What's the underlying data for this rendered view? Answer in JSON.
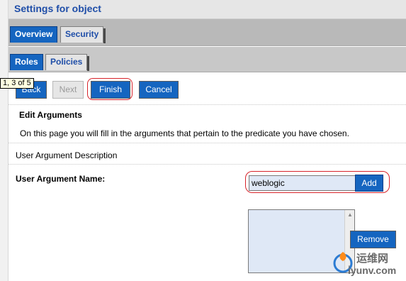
{
  "page": {
    "title": "Settings for object"
  },
  "tabs": [
    {
      "label": "Overview",
      "active": true
    },
    {
      "label": "Security",
      "active": false
    }
  ],
  "subtabs": [
    {
      "label": "Roles",
      "active": true
    },
    {
      "label": "Policies",
      "active": false
    }
  ],
  "wizard": {
    "back_label": "Back",
    "next_label": "Next",
    "finish_label": "Finish",
    "cancel_label": "Cancel",
    "tooltip": "1, 3 of 5"
  },
  "section": {
    "heading": "Edit Arguments",
    "description": "On this page you will fill in the arguments that pertain to the predicate you have chosen."
  },
  "form": {
    "description_label": "User Argument Description",
    "name_label": "User Argument Name:",
    "name_value": "weblogic",
    "add_label": "Add",
    "remove_label": "Remove",
    "list_items": []
  },
  "watermark": {
    "line1": "运维网",
    "line2": "iyunv.com"
  },
  "colors": {
    "accent": "#1565c0",
    "title": "#1f4ea8",
    "highlight": "#d7232a"
  }
}
